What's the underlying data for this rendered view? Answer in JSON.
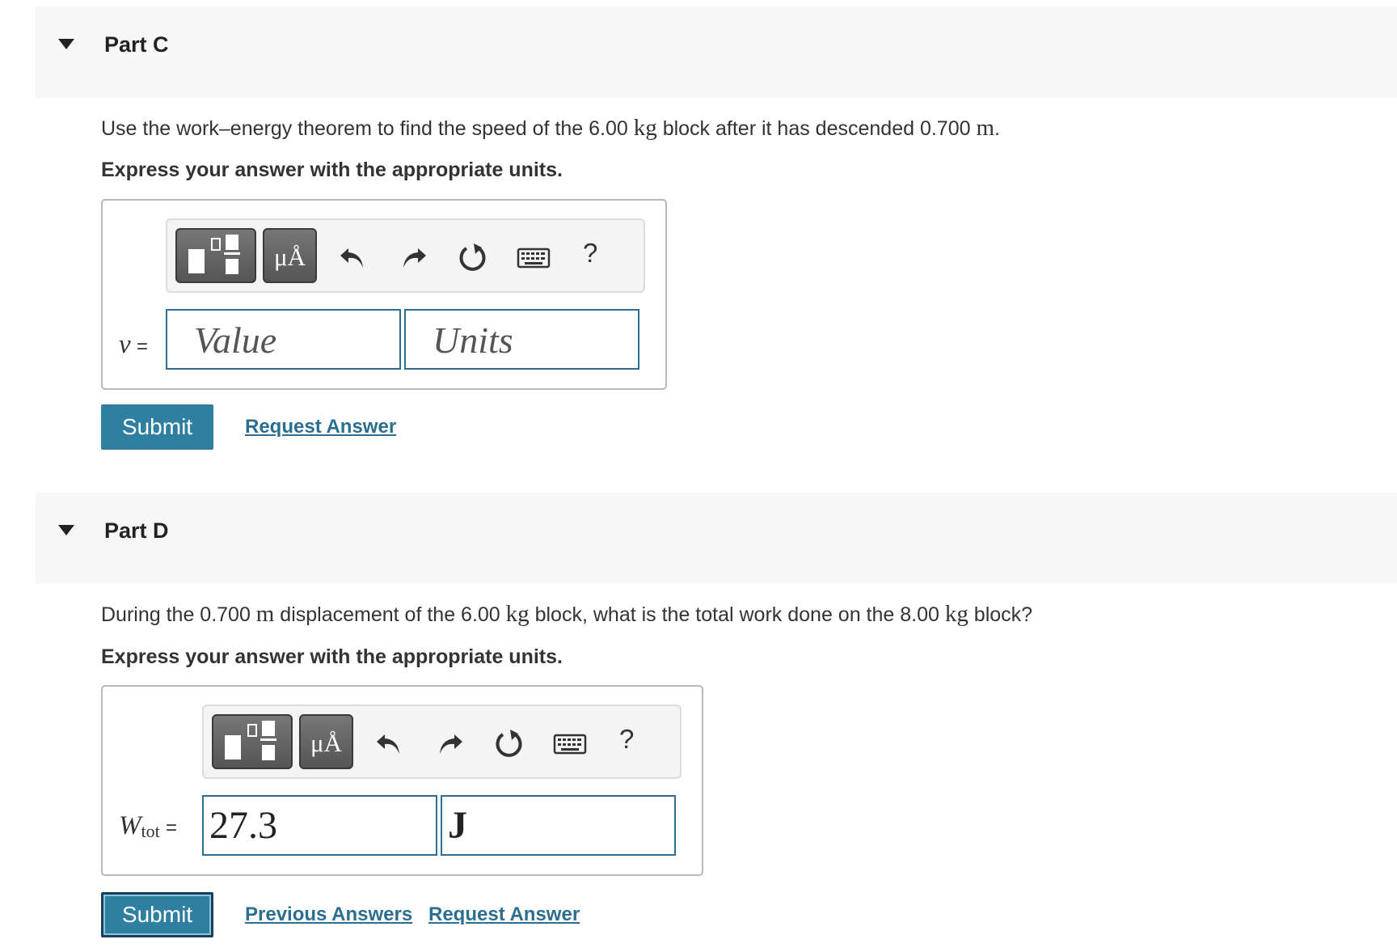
{
  "part_c": {
    "title": "Part C",
    "question": {
      "pre": "Use the work–energy theorem to find the speed of the 6.00 ",
      "unit1": "kg",
      "mid": " block after it has descended 0.700 ",
      "unit2": "m",
      "post": "."
    },
    "instruction": "Express your answer with the appropriate units.",
    "units_button": "μÅ",
    "help": "?",
    "var_symbol": "v",
    "equals": "=",
    "value_placeholder": "Value",
    "units_placeholder": "Units",
    "submit": "Submit",
    "request_answer": "Request Answer"
  },
  "part_d": {
    "title": "Part D",
    "question": {
      "pre": "During the 0.700 ",
      "unit1": "m",
      "mid1": " displacement of the 6.00 ",
      "unit2": "kg",
      "mid2": " block, what is the total work done on the 8.00 ",
      "unit3": "kg",
      "post": " block?"
    },
    "instruction": "Express your answer with the appropriate units.",
    "units_button": "μÅ",
    "help": "?",
    "var_symbol": "W",
    "var_sub": "tot",
    "equals": "=",
    "value": "27.3",
    "units_value": "J",
    "submit": "Submit",
    "previous_answers": "Previous Answers",
    "request_answer": "Request Answer"
  },
  "icons": [
    "caret-down-icon",
    "templates-icon",
    "undo-icon",
    "redo-icon",
    "reset-icon",
    "keyboard-icon",
    "help-icon"
  ]
}
